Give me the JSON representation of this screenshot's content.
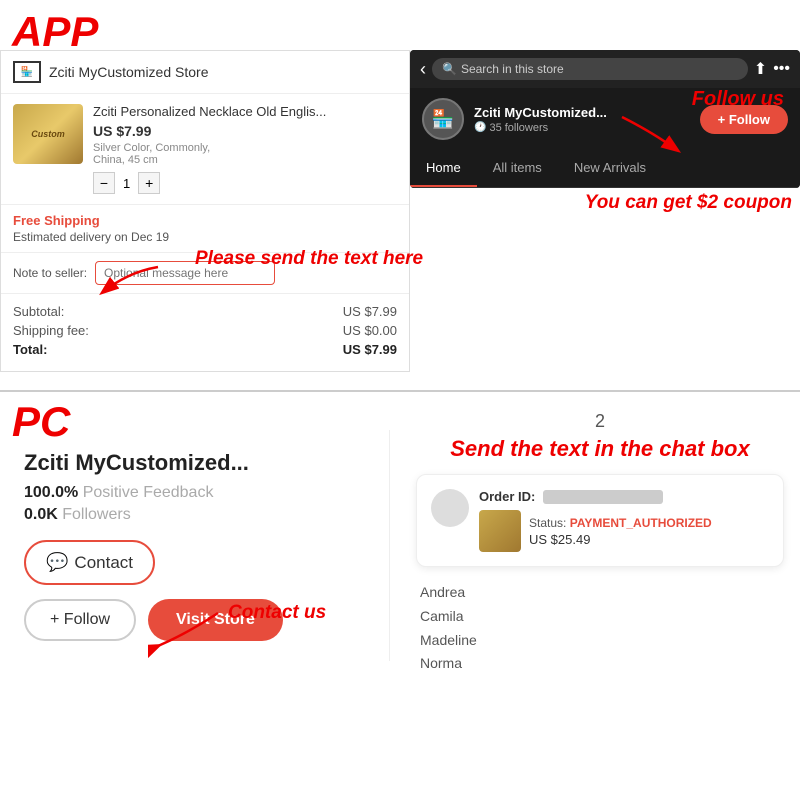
{
  "app_label": "APP",
  "pc_label": "PC",
  "store": {
    "name": "Zciti MyCustomized Store",
    "icon_text": "🏪"
  },
  "product": {
    "title": "Zciti Personalized Necklace Old Englis...",
    "price": "US $7.99",
    "details": "Silver Color, Commonly,\nChina, 45 cm",
    "quantity": "1",
    "img_text": "Custom"
  },
  "shipping": {
    "label": "Free Shipping",
    "delivery": "Estimated delivery on Dec 19"
  },
  "note": {
    "label": "Note to seller:",
    "placeholder": "Optional message here"
  },
  "totals": {
    "subtotal_label": "Subtotal:",
    "subtotal_value": "US $7.99",
    "shipping_label": "Shipping fee:",
    "shipping_value": "US $0.00",
    "total_label": "Total:",
    "total_value": "US $7.99"
  },
  "annotations": {
    "please_send": "Please send the text here",
    "follow_us": "Follow us",
    "coupon": "You can get $2 coupon",
    "contact_us": "Contact us",
    "section2": "2",
    "send_chat": "Send the text in the chat box"
  },
  "app_store": {
    "search_placeholder": "Search in this store",
    "store_name": "Zciti MyCustomized...",
    "followers": "35 followers",
    "follow_btn": "+ Follow",
    "nav": {
      "home": "Home",
      "all_items": "All items",
      "new_arrivals": "New Arrivals"
    }
  },
  "pc_store": {
    "name": "Zciti MyCustomized...",
    "feedback_pct": "100.0%",
    "feedback_label": "Positive Feedback",
    "followers_cnt": "0.0K",
    "followers_label": "Followers",
    "contact_btn": "Contact",
    "follow_btn": "+ Follow",
    "visit_btn": "Visit Store"
  },
  "chat": {
    "order_label": "Order ID:",
    "status_label": "Status:",
    "status_value": "PAYMENT_AUTHORIZED",
    "price": "US $25.49",
    "names": [
      "Andrea",
      "Camila",
      "Madeline",
      "Norma"
    ]
  }
}
